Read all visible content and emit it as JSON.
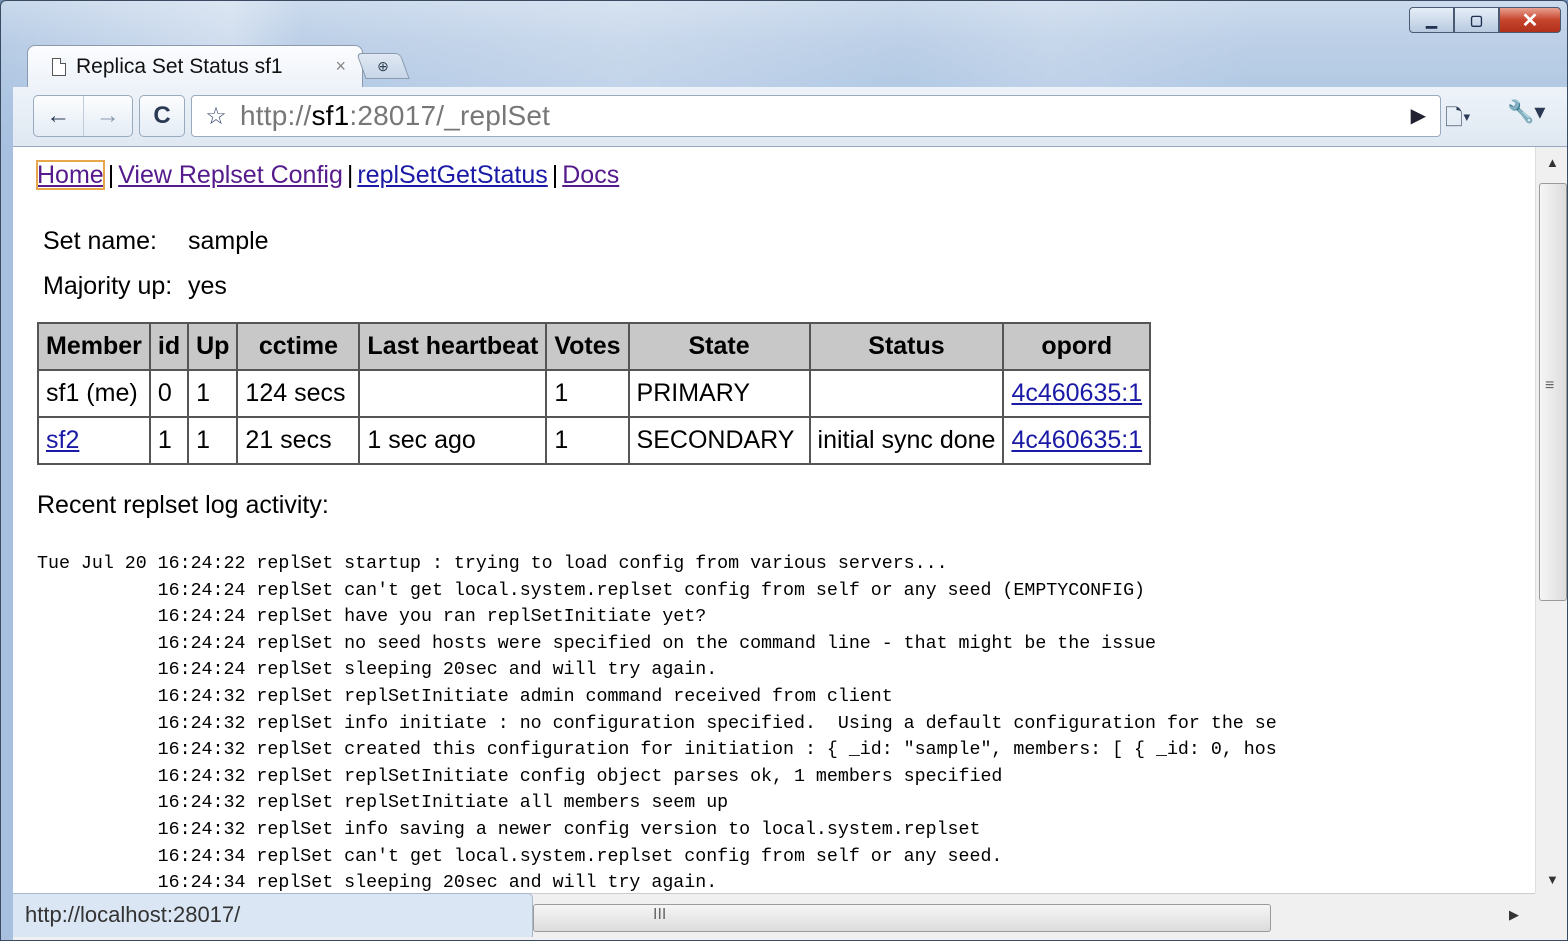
{
  "browser": {
    "tab_title": "Replica Set Status sf1",
    "tab_close": "×",
    "url_prefix": "http://",
    "url_host": "sf1",
    "url_rest": ":28017/_replSet",
    "status_url": "http://localhost:28017/"
  },
  "nav": {
    "home": "Home",
    "view_config": "View Replset Config",
    "repl_get_status": "replSetGetStatus",
    "docs": "Docs",
    "separator": "|"
  },
  "info": {
    "set_name_label": "Set name:",
    "set_name_value": "sample",
    "majority_label": "Majority up:",
    "majority_value": "yes"
  },
  "table": {
    "headers": [
      "Member",
      "id",
      "Up",
      "cctime",
      "Last heartbeat",
      "Votes",
      "State",
      "Status",
      "opord"
    ],
    "rows": [
      {
        "member": "sf1 (me)",
        "id": "0",
        "up": "1",
        "cctime": "124 secs",
        "last_heartbeat": "",
        "votes": "1",
        "state": "PRIMARY",
        "status": "",
        "opord": "4c460635:1"
      },
      {
        "member": "sf2",
        "id": "1",
        "up": "1",
        "cctime": "21 secs",
        "last_heartbeat": "1 sec ago",
        "votes": "1",
        "state": "SECONDARY",
        "status": "initial sync done",
        "opord": "4c460635:1"
      }
    ]
  },
  "log": {
    "title": "Recent replset log activity:",
    "lines": [
      "Tue Jul 20 16:24:22 replSet startup : trying to load config from various servers...",
      "           16:24:24 replSet can't get local.system.replset config from self or any seed (EMPTYCONFIG)",
      "           16:24:24 replSet have you ran replSetInitiate yet?",
      "           16:24:24 replSet no seed hosts were specified on the command line - that might be the issue",
      "           16:24:24 replSet sleeping 20sec and will try again.",
      "           16:24:32 replSet replSetInitiate admin command received from client",
      "           16:24:32 replSet info initiate : no configuration specified.  Using a default configuration for the se",
      "           16:24:32 replSet created this configuration for initiation : { _id: \"sample\", members: [ { _id: 0, hos",
      "           16:24:32 replSet replSetInitiate config object parses ok, 1 members specified",
      "           16:24:32 replSet replSetInitiate all members seem up",
      "           16:24:32 replSet info saving a newer config version to local.system.replset",
      "           16:24:34 replSet can't get local.system.replset config from self or any seed.",
      "           16:24:34 replSet sleeping 20sec and will try again."
    ]
  },
  "scroll": {
    "grip": "III",
    "vgrip": "≡"
  }
}
